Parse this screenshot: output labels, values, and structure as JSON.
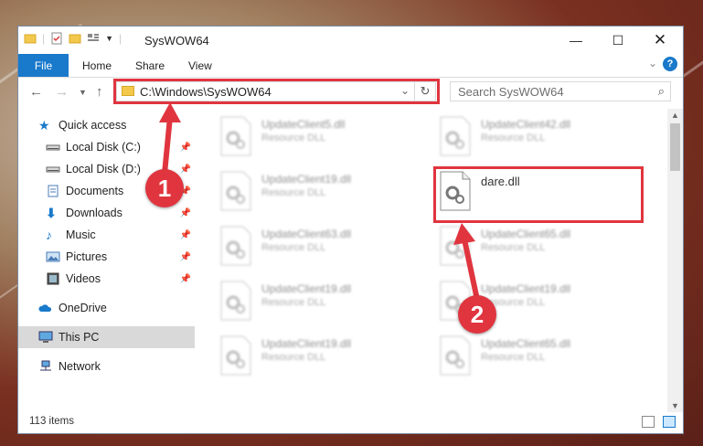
{
  "window": {
    "title": "SysWOW64"
  },
  "ribbon": {
    "tabs": [
      "File",
      "Home",
      "Share",
      "View"
    ]
  },
  "address": {
    "path": "C:\\Windows\\SysWOW64"
  },
  "search": {
    "placeholder": "Search SysWOW64"
  },
  "nav_pane": {
    "items": [
      {
        "label": "Quick access",
        "icon": "star-icon",
        "pinned": false
      },
      {
        "label": "Local Disk (C:)",
        "icon": "drive-icon",
        "pinned": true
      },
      {
        "label": "Local Disk (D:)",
        "icon": "drive-icon",
        "pinned": true
      },
      {
        "label": "Documents",
        "icon": "documents-icon",
        "pinned": true
      },
      {
        "label": "Downloads",
        "icon": "download-icon",
        "pinned": true
      },
      {
        "label": "Music",
        "icon": "music-icon",
        "pinned": true
      },
      {
        "label": "Pictures",
        "icon": "pictures-icon",
        "pinned": true
      },
      {
        "label": "Videos",
        "icon": "videos-icon",
        "pinned": true
      },
      {
        "label": "OneDrive",
        "icon": "cloud-icon",
        "pinned": false
      },
      {
        "label": "This PC",
        "icon": "computer-icon",
        "pinned": false,
        "selected": true
      },
      {
        "label": "Network",
        "icon": "network-icon",
        "pinned": false
      }
    ]
  },
  "files": [
    {
      "name": "UpdateClient5.dll",
      "type": "Resource DLL",
      "blurred": true
    },
    {
      "name": "UpdateClient42.dll",
      "type": "Resource DLL",
      "blurred": true
    },
    {
      "name": "UpdateClient19.dll",
      "type": "Resource DLL",
      "blurred": true
    },
    {
      "name": "dare.dll",
      "type": "",
      "blurred": false
    },
    {
      "name": "UpdateClient63.dll",
      "type": "Resource DLL",
      "blurred": true
    },
    {
      "name": "UpdateClient65.dll",
      "type": "Resource DLL",
      "blurred": true
    },
    {
      "name": "UpdateClient19.dll",
      "type": "Resource DLL",
      "blurred": true
    },
    {
      "name": "UpdateClient19.dll",
      "type": "Resource DLL",
      "blurred": true
    },
    {
      "name": "UpdateClient19.dll",
      "type": "Resource DLL",
      "blurred": true
    },
    {
      "name": "UpdateClient65.dll",
      "type": "Resource DLL",
      "blurred": true
    }
  ],
  "status": {
    "item_count": "113 items"
  },
  "callouts": {
    "one": "1",
    "two": "2"
  },
  "colors": {
    "accent": "#1979ca",
    "highlight": "#e0353f"
  }
}
